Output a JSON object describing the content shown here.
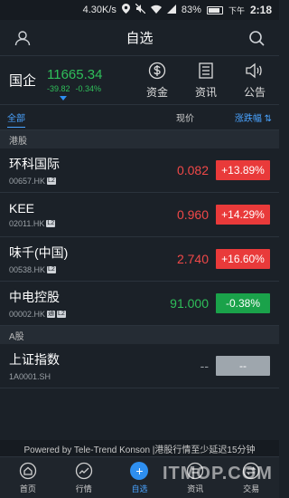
{
  "status_bar": {
    "network_speed": "4.30K/s",
    "battery": "83%",
    "ampm": "下午",
    "time": "2:18"
  },
  "navbar": {
    "title": "自选"
  },
  "index": {
    "name": "国企",
    "price": "11665.34",
    "change": "-39.82",
    "change_pct": "-0.34%"
  },
  "quick_links": [
    {
      "label": "资金",
      "icon": "dollar-circle-icon"
    },
    {
      "label": "资讯",
      "icon": "news-icon"
    },
    {
      "label": "公告",
      "icon": "speaker-icon"
    }
  ],
  "columns": {
    "all": "全部",
    "price": "现价",
    "change": "涨跌幅"
  },
  "sections": [
    {
      "title": "港股",
      "rows": [
        {
          "name": "环科国际",
          "code": "00657.HK",
          "price": "0.082",
          "change": "+13.89%",
          "trend": "up",
          "tags": [
            "L2"
          ]
        },
        {
          "name": "KEE",
          "code": "02011.HK",
          "price": "0.960",
          "change": "+14.29%",
          "trend": "up",
          "tags": [
            "L2"
          ]
        },
        {
          "name": "味千(中国)",
          "code": "00538.HK",
          "price": "2.740",
          "change": "+16.60%",
          "trend": "up",
          "tags": [
            "L2"
          ]
        },
        {
          "name": "中电控股",
          "code": "00002.HK",
          "price": "91.000",
          "change": "-0.38%",
          "trend": "down",
          "tags": [
            "通",
            "L2"
          ]
        }
      ]
    },
    {
      "title": "A股",
      "rows": [
        {
          "name": "上证指数",
          "code": "1A0001.SH",
          "price": "--",
          "change": "--",
          "trend": "flat",
          "tags": []
        }
      ]
    }
  ],
  "footer": {
    "powered_by": "Powered by Tele-Trend Konson |港股行情至少延迟15分钟"
  },
  "tabs": [
    {
      "label": "首页",
      "icon": "home-icon",
      "active": false
    },
    {
      "label": "行情",
      "icon": "chart-icon",
      "active": false
    },
    {
      "label": "自选",
      "icon": "add-circle-icon",
      "active": true
    },
    {
      "label": "资讯",
      "icon": "news-icon",
      "active": false
    },
    {
      "label": "交易",
      "icon": "trade-icon",
      "active": false
    }
  ],
  "watermark": "ITMOP.COM",
  "colors": {
    "up": "#e93a3a",
    "down": "#1aa24a",
    "accent": "#2e8ff0",
    "background": "#1b2128"
  }
}
